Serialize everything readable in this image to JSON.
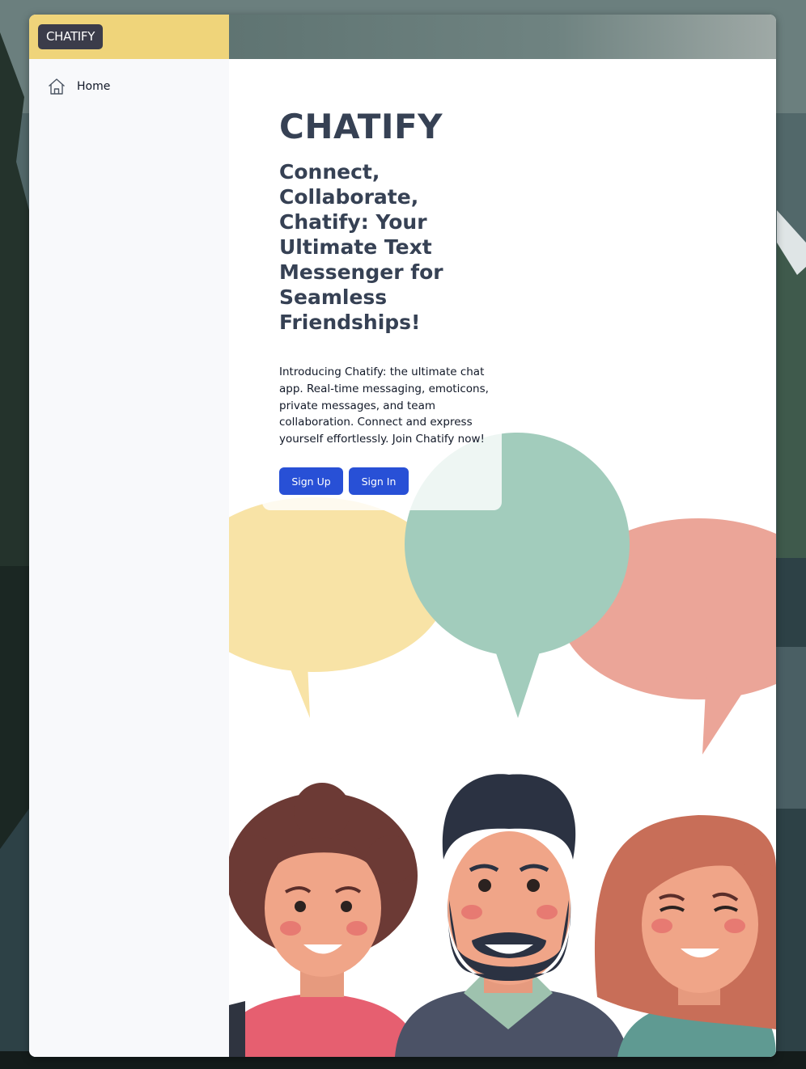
{
  "brand": {
    "badge": "CHATIFY"
  },
  "sidebar": {
    "items": [
      {
        "label": "Home",
        "icon": "home-icon"
      }
    ]
  },
  "hero": {
    "title": "CHATIFY",
    "subtitle": "Connect, Collaborate, Chatify: Your Ultimate Text Messenger for Seamless Friendships!",
    "description": "Introducing Chatify: the ultimate chat app. Real-time messaging, emoticons, private messages, and team collaboration. Connect and express yourself effortlessly. Join Chatify now!",
    "buttons": {
      "signup": "Sign Up",
      "signin": "Sign In"
    }
  },
  "colors": {
    "accent": "#2850d6",
    "topbar": "#efd47a",
    "badge": "#3b3c4a",
    "heading": "#364154",
    "bubble_yellow": "#f8e3a6",
    "bubble_green": "#a2ccbc",
    "bubble_pink": "#eba598"
  }
}
